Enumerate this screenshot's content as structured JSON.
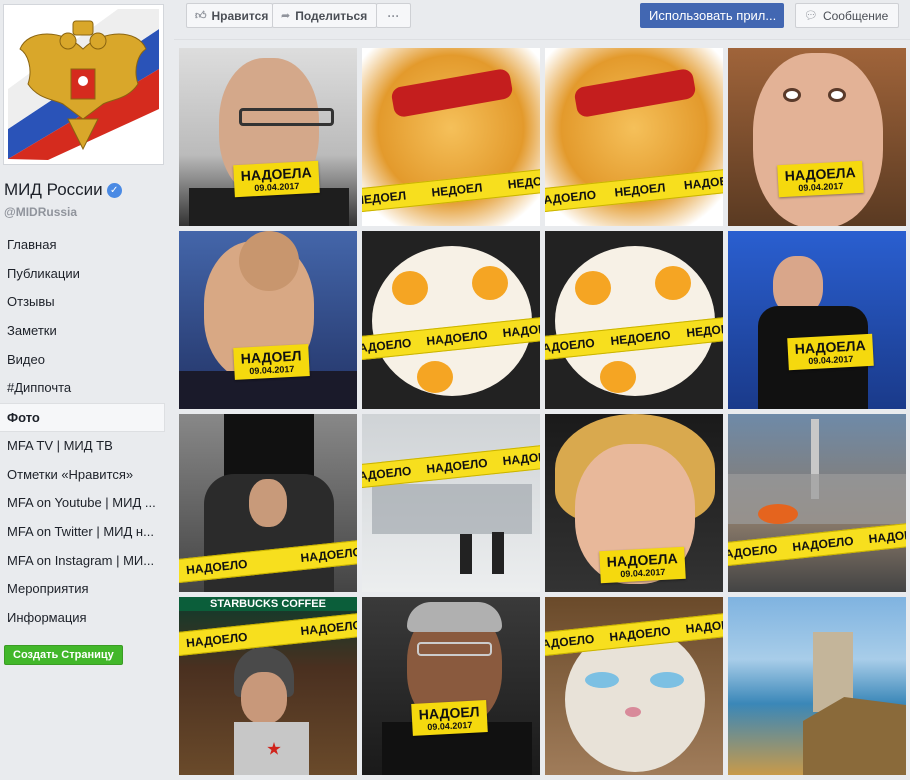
{
  "page": {
    "name": "МИД России",
    "handle": "@MIDRussia"
  },
  "nav": [
    {
      "label": "Главная",
      "active": false
    },
    {
      "label": "Публикации",
      "active": false
    },
    {
      "label": "Отзывы",
      "active": false
    },
    {
      "label": "Заметки",
      "active": false
    },
    {
      "label": "Видео",
      "active": false
    },
    {
      "label": "#Диппочта",
      "active": false
    },
    {
      "label": "Фото",
      "active": true
    },
    {
      "label": "MFA TV | МИД ТВ",
      "active": false
    },
    {
      "label": "Отметки «Нравится»",
      "active": false
    },
    {
      "label": "MFA on Youtube | МИД ...",
      "active": false
    },
    {
      "label": "MFA on Twitter | МИД н...",
      "active": false
    },
    {
      "label": "MFA on Instagram | МИ...",
      "active": false
    },
    {
      "label": "Мероприятия",
      "active": false
    },
    {
      "label": "Информация",
      "active": false
    }
  ],
  "create_page": "Создать Страницу",
  "actions": {
    "like": "Нравится",
    "share": "Поделиться",
    "more": "···",
    "use_app": "Использовать прил...",
    "message": "Сообщение"
  },
  "stickers": {
    "word_a": "НАДОЕЛ",
    "word_b": "НАДОЕЛА",
    "word_c": "НАДОЕЛО",
    "date": "09.04.2017",
    "tape_fries": "НЕДОЕЛ",
    "tape_eggs_1": "НАДОЕЛО",
    "tape_eggs_2": "НЕДОЕЛО"
  },
  "signage": {
    "starbucks": "STARBUCKS COFFEE"
  },
  "colors": {
    "accent": "#4267b2",
    "create_btn": "#42b72a",
    "tape": "#f7df1e"
  },
  "photos": [
    "man-glasses",
    "fries-ketchup",
    "fries-ketchup",
    "woman-surprised",
    "man-hand-on-head",
    "fried-eggs",
    "fried-eggs",
    "man-tongue",
    "armed-group-flag",
    "snow-street",
    "woman-smiling",
    "city-smoke",
    "starbucks-man",
    "man-glasses-older",
    "grumpy-cat",
    "castle-coast"
  ]
}
